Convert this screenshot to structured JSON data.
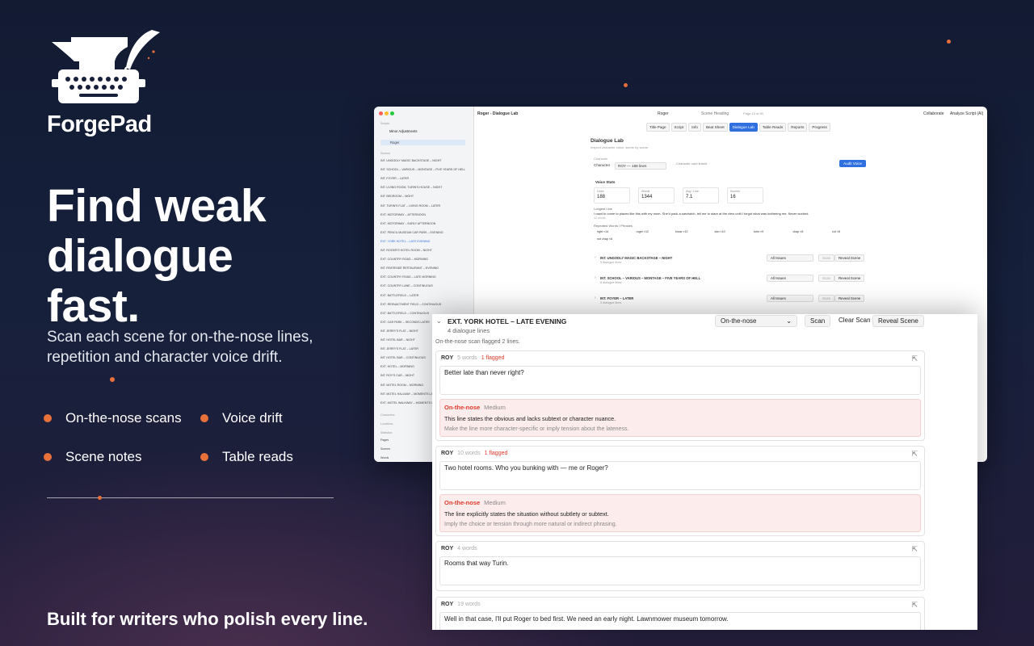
{
  "brand": {
    "name": "ForgePad",
    "accent": "#e8703a"
  },
  "hero": {
    "headline": [
      "Find weak",
      "dialogue",
      "fast."
    ],
    "subtitle": "Scan each scene for on-the-nose lines, repetition and character voice drift."
  },
  "features": [
    "On-the-nose scans",
    "Voice drift",
    "Scene notes",
    "Table reads"
  ],
  "footer": "Built for writers who polish every line.",
  "app": {
    "title": "Roger - Dialogue Lab",
    "toolbar": {
      "character": "Roger",
      "scene_heading": "Scene Heading",
      "page": "Page 13 of 90",
      "collaborate": "Collaborate",
      "analyze": "Analyze Script (AI)"
    },
    "tabs": [
      "Title Page",
      "Script",
      "Info",
      "Beat Sheet",
      "Dialogue Lab",
      "Table Reads",
      "Reports",
      "Progress"
    ],
    "active_tab": "Dialogue Lab",
    "sidebar": {
      "scripts_label": "Scripts",
      "scripts": [
        "Minor Adjustments",
        "Roger"
      ],
      "scenes_label": "Scenes",
      "scenes": [
        "INT. UNGODLY MAGIC BACKSTAGE – NIGHT",
        "INT. SCHOOL – VARIOUS – MONTAGE – FIVE YEARS OF HELL",
        "INT. FOYER – LATER",
        "INT. LIVING ROOM, TURIN'S HOUSE – NIGHT",
        "INT. BEDROOM – NIGHT",
        "INT. TURIN'S FLAT – LIVING ROOM – LATER",
        "EXT. MOTORWAY – AFTERNOON",
        "EXT. MOTORWAY – EARLY AFTERNOON",
        "EXT. PENCIL MUSEUM CAR PARK – EVENING",
        "EXT. YORK HOTEL – LATE EVENING",
        "INT. ROGER'S HOTEL ROOM – NIGHT",
        "EXT. COUNTRY ROAD – MORNING",
        "INT. RIVERSIDE RESTAURANT – EVENING",
        "EXT. COUNTRY ROAD – LATE MORNING",
        "EXT. COUNTRY LANE – CONTINUOUS",
        "EXT. BATTLEFIELD – LATER",
        "EXT. REENACTMENT FIELD – CONTINUOUS",
        "EXT. BATTLEFIELD – CONTINUOUS",
        "EXT. CAR PARK – SECONDS LATER",
        "INT. JERRY'S FLAT – NIGHT",
        "INT. HOTEL BAR – NIGHT",
        "INT. JERRY'S FLAT – LATER",
        "INT. HOTEL BAR – CONTINUOUS",
        "EXT. HOTEL – MORNING",
        "INT. ROY'S CAR – NIGHT",
        "INT. MOTEL ROOM – MORNING",
        "INT. MOTEL HALLWAY – MOMENTS LATER",
        "EXT. MOTEL WALKWAY – MOMENTS LATER"
      ],
      "active_scene": "EXT. YORK HOTEL – LATE EVENING",
      "characters_label": "Characters",
      "locations_label": "Locations",
      "statistics_label": "Statistics",
      "stats": [
        "Pages",
        "Scenes",
        "Words"
      ]
    },
    "lab": {
      "title": "Dialogue Lab",
      "subtitle": "Inspect character voice, scene by scene",
      "character_label": "Character",
      "character_field": "Character",
      "character_value": "ROY — 188 lines",
      "card_linked": "Character card linked",
      "audit": "Audit Voice",
      "voice_stats_label": "Voice Stats",
      "stats": [
        {
          "label": "Lines",
          "value": "188"
        },
        {
          "label": "Words",
          "value": "1344"
        },
        {
          "label": "Avg / Line",
          "value": "7.1"
        },
        {
          "label": "Scenes",
          "value": "16"
        }
      ],
      "longest_label": "Longest Line",
      "longest": "I used to come to places like this with my mum. She'd pack a sandwich, tell me to stare at the view until I forgot what was bothering me. Never worked.",
      "longest_meta": "42 words",
      "repeated_label": "Repeated Words / Phrases",
      "repeated": [
        "right ×14",
        "roger ×12",
        "know ×12",
        "don ×10",
        "turin ×9",
        "chap ×8",
        "cut ×8",
        "not chap ×8"
      ],
      "scenes": [
        {
          "heading": "INT. UNGODLY MAGIC BACKSTAGE – NIGHT",
          "lines": "5 dialogue lines"
        },
        {
          "heading": "INT. SCHOOL – VARIOUS – MONTAGE – FIVE YEARS OF HELL",
          "lines": "8 dialogue lines"
        },
        {
          "heading": "INT. FOYER – LATER",
          "lines": "3 dialogue lines"
        }
      ],
      "filter": "All Issues",
      "scan": "Scan",
      "reveal": "Reveal Scene"
    }
  },
  "zoom": {
    "heading": "EXT. YORK HOTEL – LATE EVENING",
    "lines": "4 dialogue lines",
    "filter": "On-the-nose",
    "scan": "Scan",
    "clear": "Clear Scan",
    "reveal": "Reveal Scene",
    "summary": "On-the-nose scan flagged 2 lines.",
    "cards": [
      {
        "name": "ROY",
        "words": "5 words",
        "flag": "1 flagged",
        "text": "Better late than never right?",
        "issue": {
          "type": "On-the-nose",
          "severity": "Medium",
          "desc": "This line states the obvious and lacks subtext or character nuance.",
          "tip": "Make the line more character-specific or imply tension about the lateness."
        }
      },
      {
        "name": "ROY",
        "words": "10 words",
        "flag": "1 flagged",
        "text": "Two hotel rooms. Who you bunking with — me or Roger?",
        "issue": {
          "type": "On-the-nose",
          "severity": "Medium",
          "desc": "The line explicitly states the situation without subtlety or subtext.",
          "tip": "Imply the choice or tension through more natural or indirect phrasing."
        }
      },
      {
        "name": "ROY",
        "words": "4 words",
        "text": "Rooms that way Turin."
      },
      {
        "name": "ROY",
        "words": "19 words",
        "text": "Well in that case, I'll put Roger to bed first. We need an early night. Lawnmower museum tomorrow."
      }
    ]
  }
}
